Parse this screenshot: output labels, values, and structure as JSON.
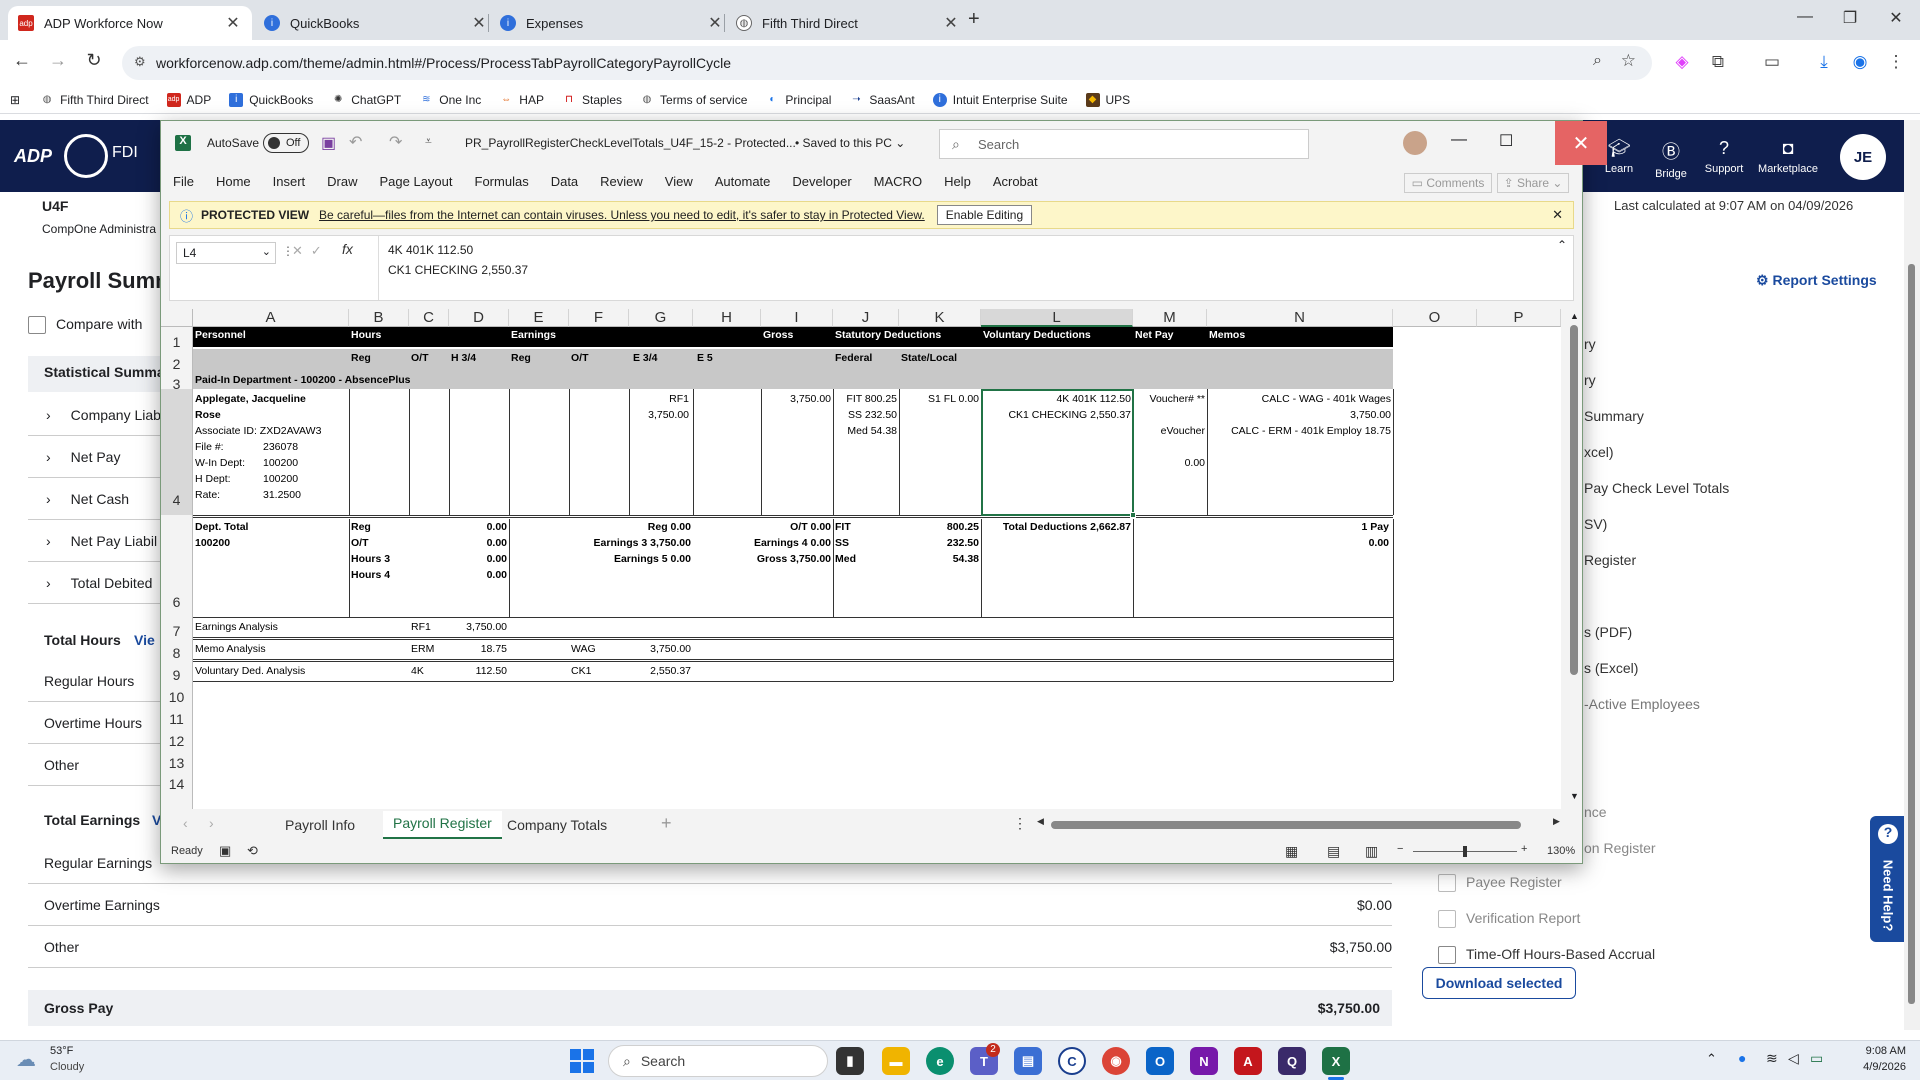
{
  "browser": {
    "tabs": [
      {
        "title": "ADP Workforce Now",
        "active": true
      },
      {
        "title": "QuickBooks",
        "active": false
      },
      {
        "title": "Expenses",
        "active": false
      },
      {
        "title": "Fifth Third Direct",
        "active": false
      }
    ],
    "url": "workforcenow.adp.com/theme/admin.html#/Process/ProcessTabPayrollCategoryPayrollCycle",
    "bookmarks": [
      "Fifth Third Direct",
      "ADP",
      "QuickBooks",
      "ChatGPT",
      "One Inc",
      "HAP",
      "Staples",
      "Terms of service",
      "Principal",
      "SaasAnt",
      "Intuit Enterprise Suite",
      "UPS"
    ]
  },
  "adp": {
    "logo": "ADP",
    "nav": [
      {
        "label": "Learn",
        "icon": "graduation-cap-icon"
      },
      {
        "label": "Bridge",
        "icon": "bridge-icon"
      },
      {
        "label": "Support",
        "icon": "help-circle-icon"
      },
      {
        "label": "Marketplace",
        "icon": "bag-icon"
      }
    ],
    "avatar": "JE",
    "company_code": "U4F",
    "company_name": "CompOne Administra",
    "last_calculated": "Last calculated at 9:07 AM on 04/09/2026",
    "page_title": "Payroll Summ",
    "compare_with": "Compare with",
    "report_settings": "Report Settings",
    "stat_summary": "Statistical Summa",
    "summary_items": [
      "Company Liab",
      "Net Pay",
      "Net Cash",
      "Net Pay Liabil",
      "Total Debited"
    ],
    "total_hours": "Total Hours",
    "view_link": "Vie",
    "hours_rows": [
      "Regular Hours",
      "Overtime Hours",
      "Other"
    ],
    "total_earnings": "Total Earnings",
    "earn_link": "V",
    "earn_rows": [
      {
        "label": "Regular Earnings",
        "amount": ""
      },
      {
        "label": "Overtime Earnings",
        "amount": "$0.00"
      },
      {
        "label": "Other",
        "amount": "$3,750.00"
      }
    ],
    "gross_pay_label": "Gross Pay",
    "gross_pay_amount": "$3,750.00",
    "reports": [
      "ry",
      "ry",
      "Summary",
      "xcel)",
      "Pay Check Level Totals",
      "SV)",
      "Register",
      "s (PDF)",
      "s (Excel)",
      "-Active Employees",
      "nce",
      "on Register"
    ],
    "checkbox_reports": [
      "Payee Register",
      "Verification Report",
      "Time-Off Hours-Based Accrual"
    ],
    "download_selected": "Download selected",
    "need_help": "Need Help?"
  },
  "excel": {
    "autosave_label": "AutoSave",
    "autosave_state": "Off",
    "filename": "PR_PayrollRegisterCheckLevelTotals_U4F_15-2  -  Protected...",
    "saved": "Saved to this PC",
    "search_placeholder": "Search",
    "menu": [
      "File",
      "Home",
      "Insert",
      "Draw",
      "Page Layout",
      "Formulas",
      "Data",
      "Review",
      "View",
      "Automate",
      "Developer",
      "MACRO",
      "Help",
      "Acrobat"
    ],
    "comments": "Comments",
    "share": "Share",
    "protected_label": "PROTECTED VIEW",
    "protected_msg": "Be careful—files from the Internet can contain viruses. Unless you need to edit, it's safer to stay in Protected View.",
    "enable_editing": "Enable Editing",
    "name_box": "L4",
    "formula_line1": "4K 401K  112.50",
    "formula_line2": "CK1 CHECKING  2,550.37",
    "columns": [
      "A",
      "B",
      "C",
      "D",
      "E",
      "F",
      "G",
      "H",
      "I",
      "J",
      "K",
      "L",
      "M",
      "N",
      "O",
      "P"
    ],
    "rows": [
      "1",
      "2",
      "3",
      "4",
      "6",
      "7",
      "8",
      "9",
      "10",
      "11",
      "12",
      "13",
      "14"
    ],
    "hdr1": {
      "personnel": "Personnel",
      "hours": "Hours",
      "earnings": "Earnings",
      "gross": "Gross",
      "statutory": "Statutory Deductions",
      "voluntary": "Voluntary Deductions",
      "netpay": "Net Pay",
      "memos": "Memos"
    },
    "hdr2": {
      "reg": "Reg",
      "ot": "O/T",
      "h34": "H 3/4",
      "ereg": "Reg",
      "eot": "O/T",
      "e34": "E 3/4",
      "e5": "E 5",
      "federal": "Federal",
      "statelocal": "State/Local"
    },
    "dept_row": "Paid-In Department - 100200 - AbsencePlus",
    "employee": {
      "name1": "Applegate,  Jacqueline",
      "name2": "Rose",
      "assoc": "Associate ID: ZXD2AVAW3",
      "file_label": "File #:",
      "file": "236078",
      "win_label": "W-In Dept:",
      "win": "100200",
      "hd_label": "H Dept:",
      "hd": "100200",
      "rate_label": "Rate:",
      "rate": "31.2500",
      "rf1": "RF1",
      "rf1_amt": "3,750.00",
      "gross": "3,750.00",
      "fit": "FIT  800.25",
      "ss": "SS  232.50",
      "med": "Med  54.38",
      "s1": "S1  FL  0.00",
      "vol1": "4K 401K   112.50",
      "vol2": "CK1 CHECKING   2,550.37",
      "voucher": "Voucher# **",
      "evoucher": "eVoucher",
      "net": "0.00",
      "memo1": "CALC - WAG - 401k Wages",
      "memo2": "3,750.00",
      "memo3": "CALC - ERM - 401k Employ  18.75"
    },
    "dept_total": {
      "label": "Dept. Total",
      "code": "100200",
      "h_labels": [
        "Reg",
        "O/T",
        "Hours 3",
        "Hours 4"
      ],
      "h_vals": [
        "0.00",
        "0.00",
        "0.00",
        "0.00"
      ],
      "e1": "Reg   0.00",
      "e2": "Earnings 3   3,750.00",
      "e3": "Earnings 5   0.00",
      "e4": "O/T   0.00",
      "e5": "Earnings 4   0.00",
      "e6": "Gross   3,750.00",
      "s_labels": [
        "FIT",
        "SS",
        "Med"
      ],
      "s_vals": [
        "800.25",
        "232.50",
        "54.38"
      ],
      "total_ded": "Total Deductions 2,662.87",
      "pay": "1 Pay",
      "pay_amt": "0.00"
    },
    "analysis": [
      {
        "label": "Earnings Analysis",
        "c1": "RF1",
        "v1": "3,750.00",
        "c2": "",
        "v2": ""
      },
      {
        "label": "Memo Analysis",
        "c1": "ERM",
        "v1": "18.75",
        "c2": "WAG",
        "v2": "3,750.00"
      },
      {
        "label": "Voluntary Ded. Analysis",
        "c1": "4K",
        "v1": "112.50",
        "c2": "CK1",
        "v2": "2,550.37"
      }
    ],
    "sheets": [
      "Payroll Info",
      "Payroll Register",
      "Company Totals"
    ],
    "active_sheet": "Payroll Register",
    "status_ready": "Ready",
    "zoom": "130%"
  },
  "taskbar": {
    "weather_temp": "53°F",
    "weather_desc": "Cloudy",
    "search": "Search",
    "time": "9:08 AM",
    "date": "4/9/2026",
    "teams_badge": "2"
  }
}
